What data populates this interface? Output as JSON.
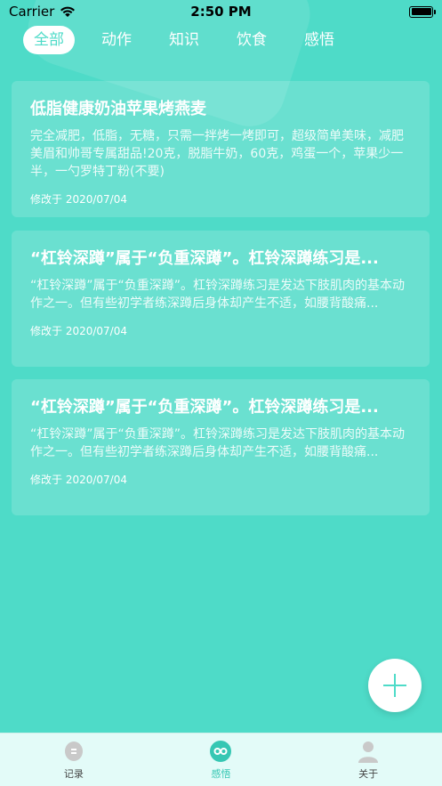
{
  "status_bar": {
    "carrier": "Carrier",
    "time": "2:50 PM"
  },
  "tabs": [
    {
      "label": "全部",
      "active": true
    },
    {
      "label": "动作",
      "active": false
    },
    {
      "label": "知识",
      "active": false
    },
    {
      "label": "饮食",
      "active": false
    },
    {
      "label": "感悟",
      "active": false
    }
  ],
  "cards": [
    {
      "title": "低脂健康奶油苹果烤燕麦",
      "body": "完全减肥，低脂，无糖，只需一拌烤一烤即可，超级简单美味，减肥美眉和帅哥专属甜品!20克，脱脂牛奶，60克，鸡蛋一个，苹果少一半，一勺罗特丁粉(不要)",
      "date": "修改于 2020/07/04"
    },
    {
      "title": "“杠铃深蹲”属于“负重深蹲”。杠铃深蹲练习是...",
      "body": "“杠铃深蹲”属于“负重深蹲”。杠铃深蹲练习是发达下肢肌肉的基本动作之一。但有些初学者练深蹲后身体却产生不适，如腰背酸痛...",
      "date": "修改于 2020/07/04"
    },
    {
      "title": "“杠铃深蹲”属于“负重深蹲”。杠铃深蹲练习是...",
      "body": "“杠铃深蹲”属于“负重深蹲”。杠铃深蹲练习是发达下肢肌肉的基本动作之一。但有些初学者练深蹲后身体却产生不适，如腰背酸痛...",
      "date": "修改于 2020/07/04"
    }
  ],
  "fab": {
    "icon": "plus-icon"
  },
  "tabbar": [
    {
      "label": "记录",
      "icon": "record-icon",
      "active": false
    },
    {
      "label": "感悟",
      "icon": "insight-icon",
      "active": true
    },
    {
      "label": "关于",
      "icon": "user-icon",
      "active": false
    }
  ],
  "colors": {
    "background": "#4edbc8",
    "accent": "#36c7b3",
    "tabbar_bg": "#e3fbf8"
  }
}
